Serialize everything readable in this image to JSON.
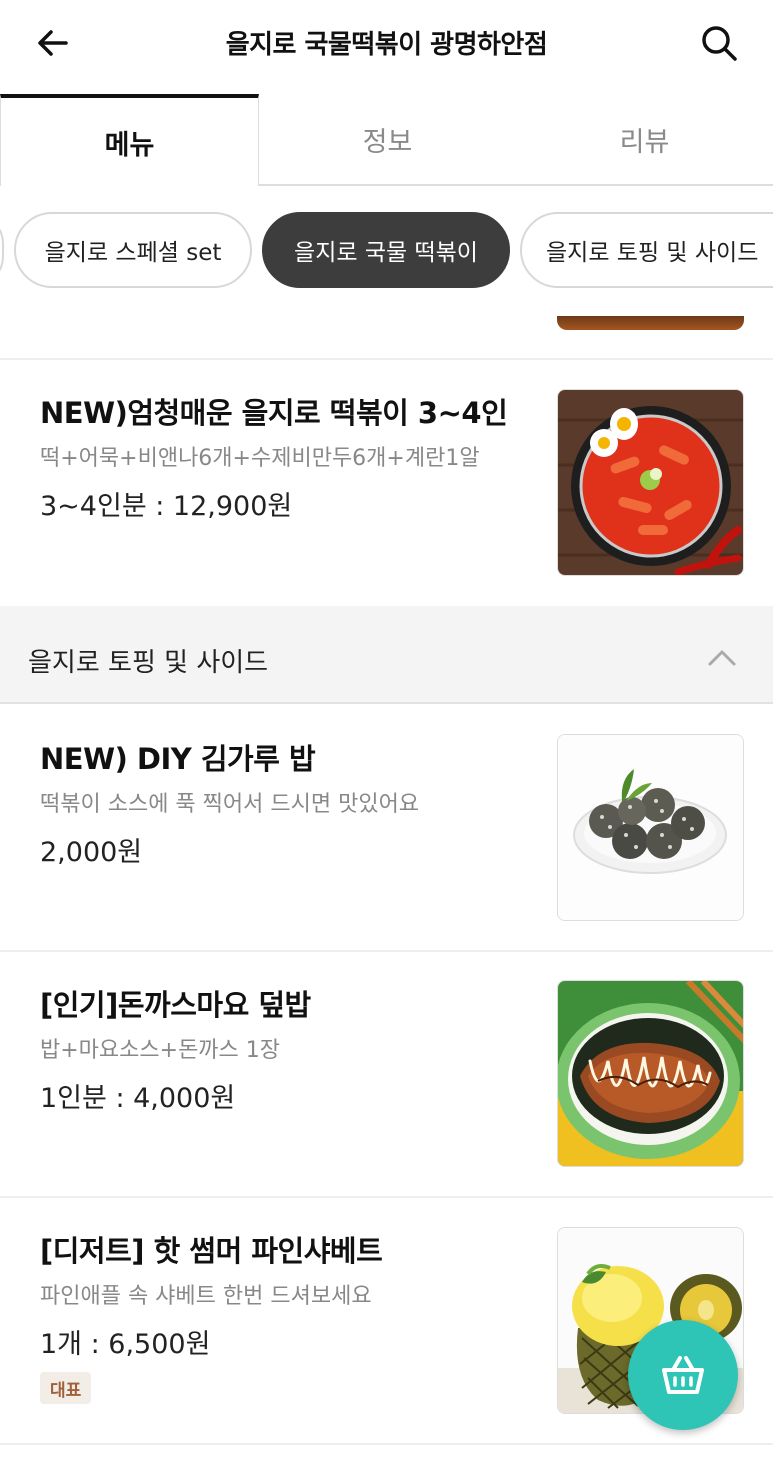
{
  "header": {
    "title": "을지로 국물떡볶이 광명하안점",
    "back_icon": "arrow-left-icon",
    "search_icon": "search-icon"
  },
  "tabs": [
    {
      "label": "메뉴",
      "active": true
    },
    {
      "label": "정보",
      "active": false
    },
    {
      "label": "리뷰",
      "active": false
    }
  ],
  "categories": [
    {
      "label": "을지로 스페셜 set",
      "active": false
    },
    {
      "label": "을지로 국물 떡볶이",
      "active": true
    },
    {
      "label": "을지로 토핑 및 사이드",
      "active": false
    }
  ],
  "menu": {
    "items": [
      {
        "name": "NEW)엄청매운 을지로 떡볶이 3~4인",
        "desc": "떡+어묵+비앤나6개+수제비만두6개+계란1알",
        "price": "3~4인분 : 12,900원"
      },
      {
        "name": "NEW) DIY 김가루 밥",
        "desc": "떡볶이 소스에 푹 찍어서 드시면 맛있어요",
        "price": "2,000원"
      },
      {
        "name": "[인기]돈까스마요 덮밥",
        "desc": "밥+마요소스+돈까스 1장",
        "price": "1인분 : 4,000원"
      },
      {
        "name": "[디저트] 핫 썸머 파인샤베트",
        "desc": "파인애플 속 샤베트 한번 드셔보세요",
        "price": "1개 : 6,500원",
        "badge": "대표"
      }
    ]
  },
  "section": {
    "title": "을지로 토핑 및 사이드",
    "chevron_icon": "chevron-up-icon"
  },
  "cart": {
    "icon": "basket-icon"
  },
  "colors": {
    "accent": "#2ec4b6",
    "active_chip": "#3d3d3d",
    "section_bg": "#f4f4f4",
    "badge_text": "#a0603a",
    "badge_bg": "#f3ede7"
  }
}
